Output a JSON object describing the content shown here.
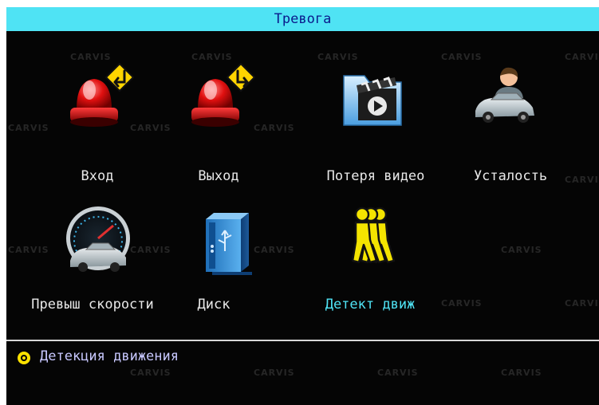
{
  "title": "Тревога",
  "watermark": "CARVIS",
  "items": [
    {
      "label": "Вход",
      "icon": "alarm-input-icon",
      "selected": false
    },
    {
      "label": "Выход",
      "icon": "alarm-output-icon",
      "selected": false
    },
    {
      "label": "Потеря видео",
      "icon": "video-loss-icon",
      "selected": false
    },
    {
      "label": "Усталость",
      "icon": "fatigue-icon",
      "selected": false
    },
    {
      "label": "Превыш скорости",
      "icon": "speedometer-icon",
      "selected": false
    },
    {
      "label": "Диск",
      "icon": "disk-icon",
      "selected": false
    },
    {
      "label": "Детект движ",
      "icon": "motion-detect-icon",
      "selected": true
    }
  ],
  "status": {
    "text": "Детекция движения"
  },
  "colors": {
    "title_bar": "#4fe3f4",
    "selected_label": "#4fe3f4",
    "bullet": "#ffe200",
    "background": "#050505"
  }
}
